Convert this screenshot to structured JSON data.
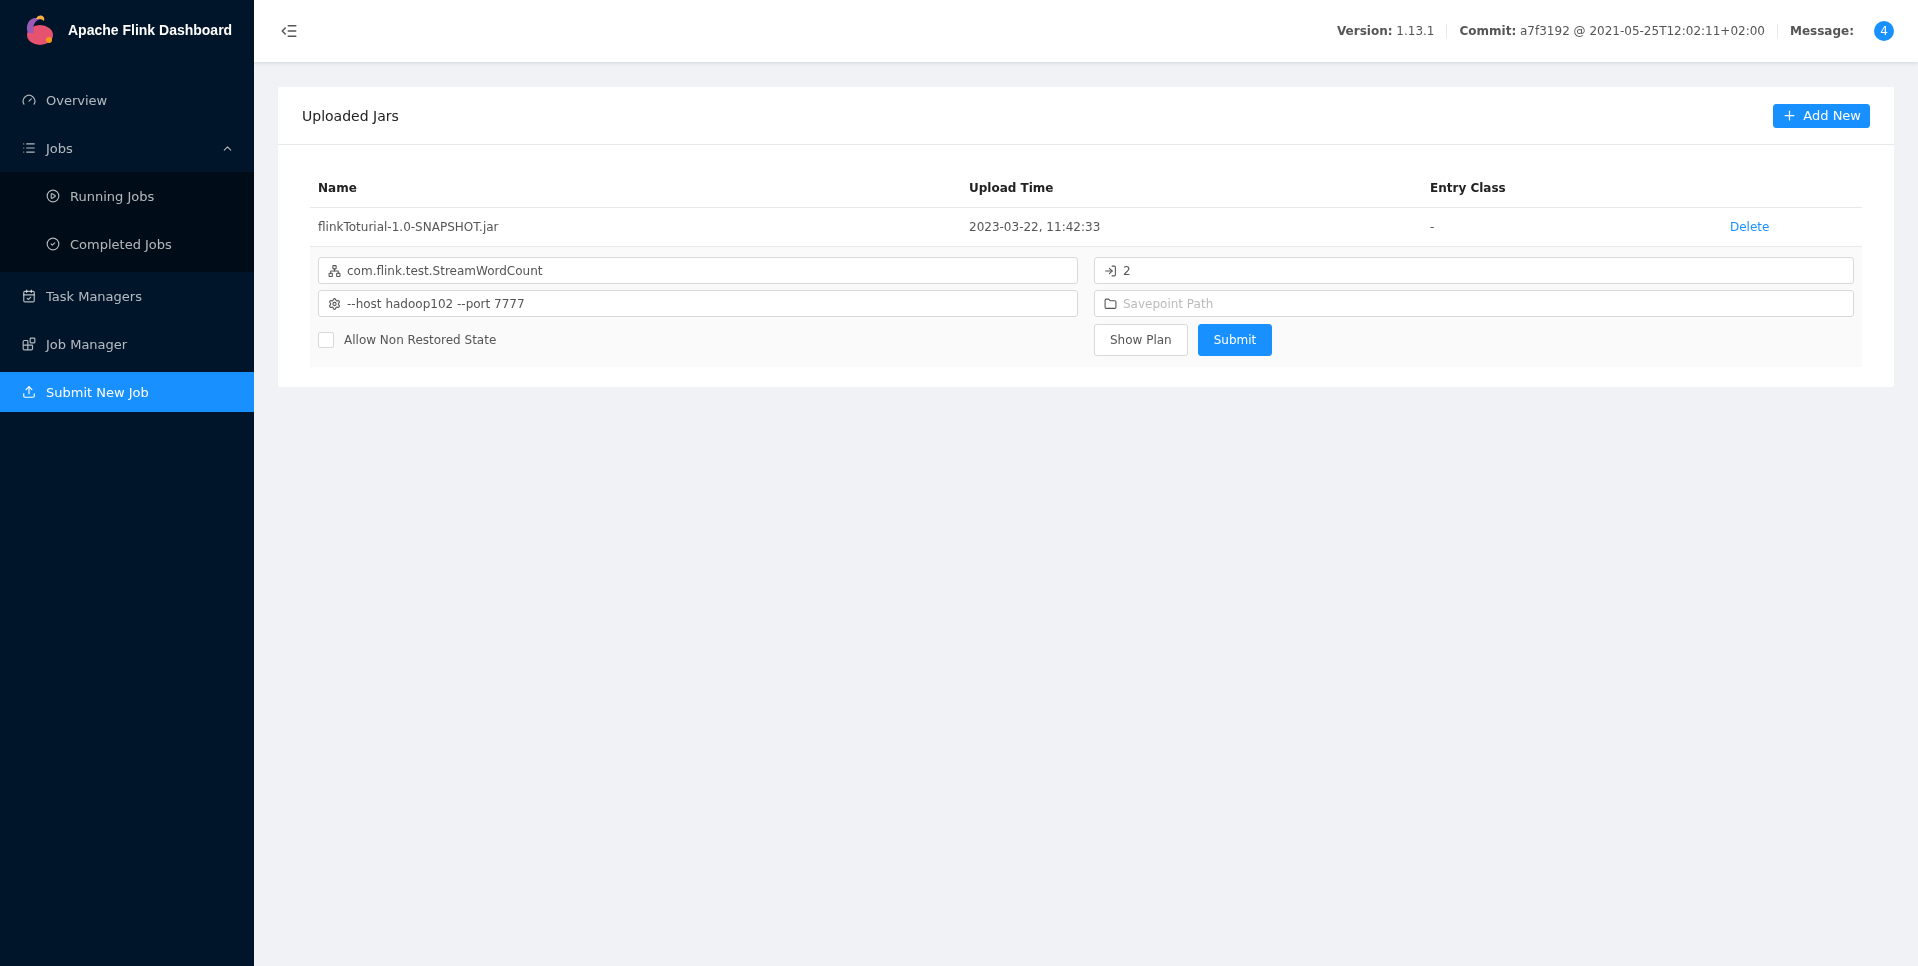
{
  "sidebar": {
    "title": "Apache Flink Dashboard",
    "items": [
      {
        "label": "Overview",
        "selected": false
      },
      {
        "label": "Jobs",
        "selected": false,
        "expanded": true,
        "children": [
          {
            "label": "Running Jobs",
            "selected": false
          },
          {
            "label": "Completed Jobs",
            "selected": false
          }
        ]
      },
      {
        "label": "Task Managers",
        "selected": false
      },
      {
        "label": "Job Manager",
        "selected": false
      },
      {
        "label": "Submit New Job",
        "selected": true
      }
    ]
  },
  "header": {
    "info": [
      {
        "label": "Version:",
        "value": "1.13.1"
      },
      {
        "label": "Commit:",
        "value": "a7f3192 @ 2021-05-25T12:02:11+02:00"
      },
      {
        "label": "Message:",
        "badge": "4"
      }
    ]
  },
  "card": {
    "title": "Uploaded Jars",
    "add_button": "Add New",
    "table": {
      "columns": [
        "Name",
        "Upload Time",
        "Entry Class"
      ],
      "rows": [
        {
          "name": "flinkToturial-1.0-SNAPSHOT.jar",
          "upload_time": "2023-03-22, 11:42:33",
          "entry_class": "-",
          "action": "Delete"
        }
      ]
    },
    "form": {
      "fields": [
        {
          "value": "com.flink.test.StreamWordCount"
        },
        {
          "value": "2"
        },
        {
          "value": "--host hadoop102 --port 7777"
        },
        {
          "placeholder": "Savepoint Path"
        }
      ],
      "checkbox": {
        "label": "Allow Non Restored State",
        "checked": false
      },
      "buttons": [
        {
          "label": "Show Plan",
          "kind": "default"
        },
        {
          "label": "Submit",
          "kind": "primary"
        }
      ]
    }
  }
}
